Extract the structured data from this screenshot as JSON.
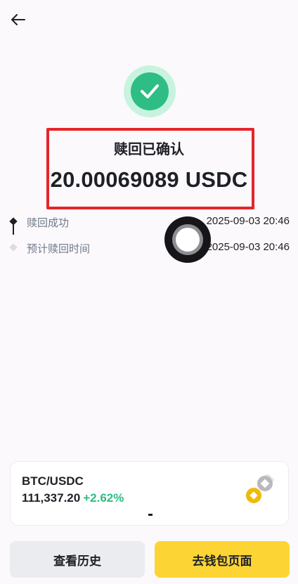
{
  "header": {
    "back_icon": "arrow-left-icon"
  },
  "status": {
    "icon": "check-icon",
    "success_color": "#2ebd85",
    "title": "赎回已确认",
    "amount": "20.00069089 USDC"
  },
  "timeline": [
    {
      "label": "赎回成功",
      "time": "2025-09-03 20:46",
      "state": "done"
    },
    {
      "label": "预计赎回时间",
      "time": "2025-09-03 20:46",
      "state": "pending"
    }
  ],
  "ticker": {
    "pair": "BTC/USDC",
    "price": "111,337.20",
    "change": "+2.62%",
    "change_color": "#2ebd85",
    "icon": "coin-pair-icon"
  },
  "actions": {
    "history_label": "查看历史",
    "wallet_label": "去钱包页面",
    "primary_color": "#fcd535"
  }
}
